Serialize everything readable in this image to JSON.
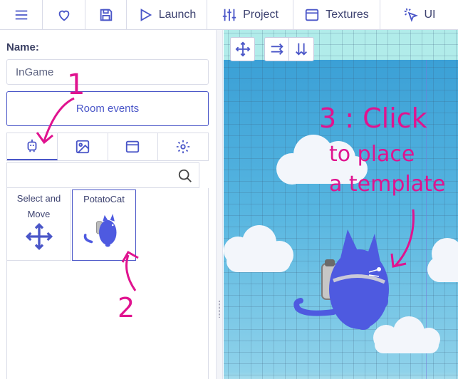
{
  "toolbar": {
    "items": [
      {
        "icon": "menu-icon",
        "label": ""
      },
      {
        "icon": "heart-icon",
        "label": ""
      },
      {
        "icon": "save-icon",
        "label": ""
      },
      {
        "icon": "play-icon",
        "label": "Launch"
      },
      {
        "icon": "sliders-icon",
        "label": "Project"
      },
      {
        "icon": "window-icon",
        "label": "Textures"
      },
      {
        "icon": "cursor-click-icon",
        "label": "UI"
      }
    ]
  },
  "room": {
    "name_label": "Name:",
    "name_value": "InGame",
    "events_button": "Room events"
  },
  "tabs": [
    {
      "icon": "robot-icon",
      "active": true
    },
    {
      "icon": "image-icon",
      "active": false
    },
    {
      "icon": "window-icon",
      "active": false
    },
    {
      "icon": "gear-icon",
      "active": false
    }
  ],
  "search": {
    "placeholder": ""
  },
  "templates": [
    {
      "label": "Select and Move",
      "icon": "move-arrows-icon",
      "selected": false
    },
    {
      "label": "PotatoCat",
      "icon": "potatocat-thumbnail",
      "selected": true
    }
  ],
  "canvas": {
    "tools": [
      "move-arrows-icon",
      "arrow-right-icon",
      "arrow-down-icon"
    ]
  },
  "annotations": {
    "step1": "1",
    "step2": "2",
    "step3_line1": "3 : Click",
    "step3_line2": "to place",
    "step3_line3": "a template"
  },
  "colors": {
    "accent": "#4a56c8",
    "annotation": "#e0138f",
    "sky_top": "#3ba0d6",
    "cat_body": "#4e5ae0"
  }
}
